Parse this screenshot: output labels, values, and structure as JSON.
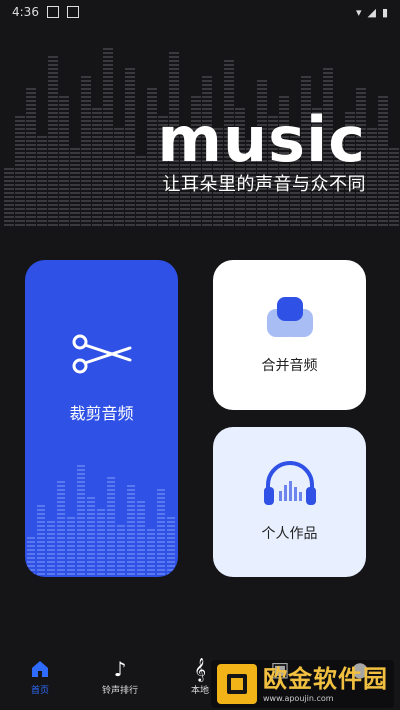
{
  "status": {
    "time": "4:36"
  },
  "hero": {
    "logo": "music",
    "tagline": "让耳朵里的声音与众不同"
  },
  "cards": {
    "trim": {
      "label": "裁剪音频"
    },
    "merge": {
      "label": "合并音频"
    },
    "works": {
      "label": "个人作品"
    }
  },
  "nav": {
    "items": [
      {
        "label": "首页",
        "active": true
      },
      {
        "label": "铃声排行"
      },
      {
        "label": "本地"
      },
      {
        "label": ""
      },
      {
        "label": ""
      }
    ]
  },
  "watermark": {
    "text": "欧金软件园",
    "url": "www.apoujin.com"
  },
  "colors": {
    "accent": "#2f51e6",
    "nav_active": "#2f6bff",
    "bg": "#151517"
  }
}
